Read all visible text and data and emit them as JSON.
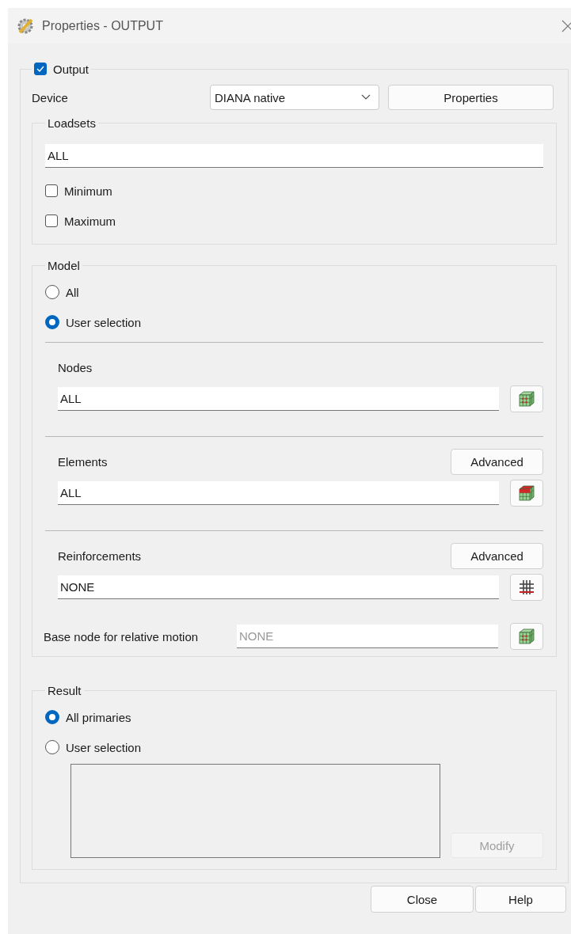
{
  "window": {
    "title": "Properties - OUTPUT"
  },
  "output": {
    "label": "Output",
    "checked": true,
    "device": {
      "label": "Device",
      "value": "DIANA native",
      "button": "Properties"
    },
    "loadsets": {
      "title": "Loadsets",
      "value": "ALL",
      "options": [
        {
          "label": "Minimum",
          "checked": false
        },
        {
          "label": "Maximum",
          "checked": false
        }
      ]
    },
    "model": {
      "title": "Model",
      "options": [
        {
          "label": "All",
          "selected": false
        },
        {
          "label": "User selection",
          "selected": true
        }
      ],
      "sections": [
        {
          "label": "Nodes",
          "value": "ALL",
          "kind": "nodes"
        },
        {
          "label": "Elements",
          "value": "ALL",
          "kind": "elements",
          "advanced": "Advanced"
        },
        {
          "label": "Reinforcements",
          "value": "NONE",
          "kind": "grid",
          "advanced": "Advanced"
        }
      ],
      "base_node": {
        "label": "Base node for relative motion",
        "placeholder": "NONE",
        "kind": "nodes"
      }
    },
    "result": {
      "title": "Result",
      "options": [
        {
          "label": "All primaries",
          "selected": true
        },
        {
          "label": "User selection",
          "selected": false
        }
      ],
      "modify": {
        "label": "Modify",
        "disabled": true
      }
    }
  },
  "buttons": [
    "Close",
    "Help"
  ]
}
